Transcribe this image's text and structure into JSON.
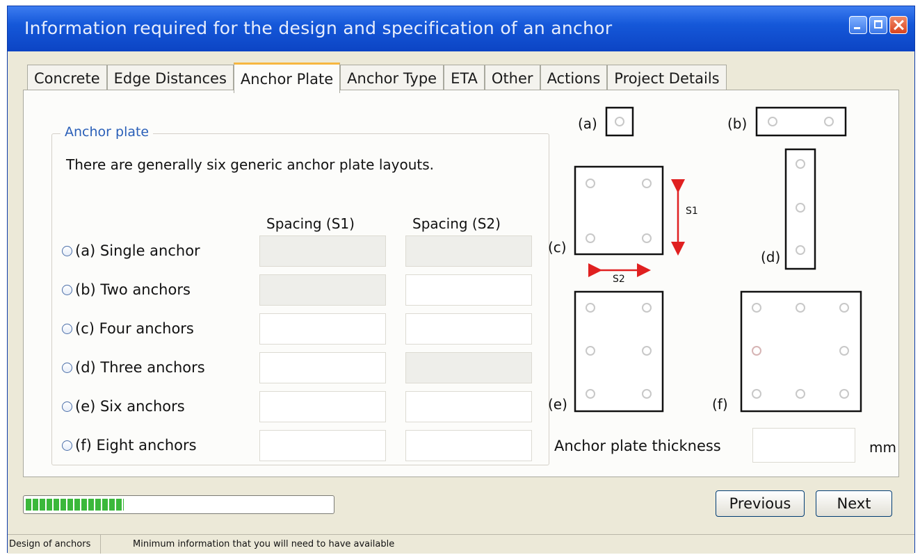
{
  "window": {
    "title": "Information required for the design and specification of an anchor",
    "controls": [
      "minimize-icon",
      "maximize-icon",
      "close-icon"
    ]
  },
  "tabs": [
    {
      "label": "Concrete",
      "active": false
    },
    {
      "label": "Edge Distances",
      "active": false
    },
    {
      "label": "Anchor Plate",
      "active": true
    },
    {
      "label": "Anchor Type",
      "active": false
    },
    {
      "label": "ETA",
      "active": false
    },
    {
      "label": "Other",
      "active": false
    },
    {
      "label": "Actions",
      "active": false
    },
    {
      "label": "Project Details",
      "active": false
    }
  ],
  "anchor_plate": {
    "group_title": "Anchor plate",
    "description": "There are generally six generic anchor plate layouts.",
    "col_s1": "Spacing (S1)",
    "col_s2": "Spacing (S2)",
    "options": [
      {
        "label": "(a) Single anchor",
        "s1": "",
        "s2": "",
        "s1_enabled": false,
        "s2_enabled": false
      },
      {
        "label": "(b) Two anchors",
        "s1": "",
        "s2": "",
        "s1_enabled": false,
        "s2_enabled": true
      },
      {
        "label": "(c) Four anchors",
        "s1": "",
        "s2": "",
        "s1_enabled": true,
        "s2_enabled": true
      },
      {
        "label": "(d) Three anchors",
        "s1": "",
        "s2": "",
        "s1_enabled": true,
        "s2_enabled": false
      },
      {
        "label": "(e) Six anchors",
        "s1": "",
        "s2": "",
        "s1_enabled": true,
        "s2_enabled": true
      },
      {
        "label": "(f) Eight anchors",
        "s1": "",
        "s2": "",
        "s1_enabled": true,
        "s2_enabled": true
      }
    ]
  },
  "diagram": {
    "labels": {
      "a": "(a)",
      "b": "(b)",
      "c": "(c)",
      "d": "(d)",
      "e": "(e)",
      "f": "(f)"
    },
    "s1": "S1",
    "s2": "S2",
    "arrow_color": "#e02020"
  },
  "thickness": {
    "label": "Anchor plate thickness",
    "value": "",
    "unit": "mm"
  },
  "progress": {
    "fraction": 0.32,
    "color": "#3bb83b"
  },
  "buttons": {
    "previous": "Previous",
    "next": "Next"
  },
  "status": {
    "left": "Design of anchors",
    "right": "Minimum information that you will need to have available"
  }
}
